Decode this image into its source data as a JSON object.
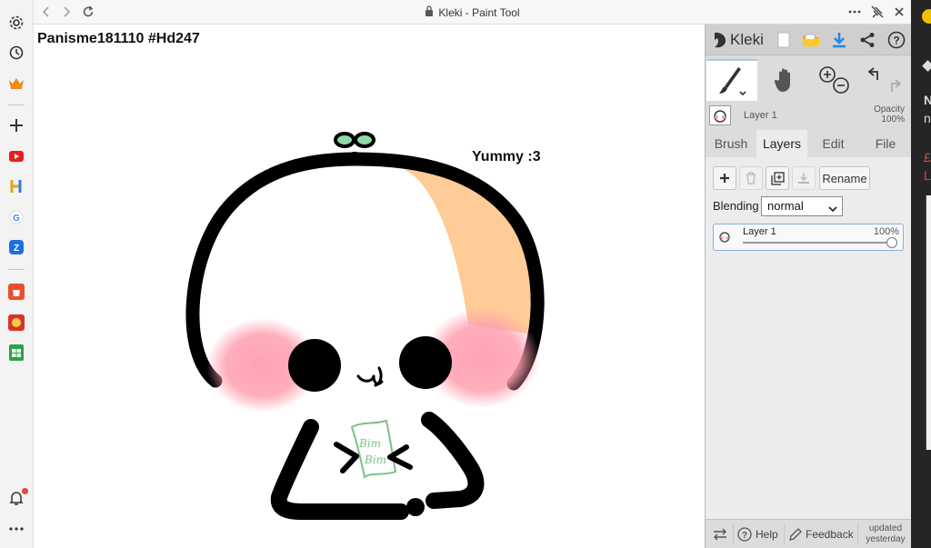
{
  "browser": {
    "window_title": "Kleki - Paint Tool",
    "sidebar_icons": [
      "settings-icon",
      "history-icon",
      "crown-icon",
      "plus-icon",
      "youtube-icon",
      "h-app-icon",
      "google-icon",
      "zalo-icon",
      "shopee-icon",
      "game-icon",
      "sheets-icon",
      "bell-icon",
      "more-icon"
    ]
  },
  "canvas": {
    "title_text": "Panisme181110 #Hd247",
    "note_text": "Yummy :3",
    "bag_text_line1": "Bim",
    "bag_text_line2": "Bim",
    "colors": {
      "outline": "#000000",
      "blush": "#ff9fb0",
      "stripe": "#ffcb96",
      "sprout": "#8fd9a8",
      "bag": "#7fbf87"
    }
  },
  "panel": {
    "brand": "Kleki",
    "layer_preview_name": "Layer 1",
    "opacity_label": "Opacity",
    "opacity_value": "100%",
    "tabs": [
      {
        "label": "Brush",
        "active": false
      },
      {
        "label": "Layers",
        "active": true
      },
      {
        "label": "Edit",
        "active": false
      },
      {
        "label": "File",
        "active": false
      }
    ],
    "rename_label": "Rename",
    "blending_label": "Blending",
    "blending_value": "normal",
    "layers": [
      {
        "name": "Layer 1",
        "opacity": "100%",
        "opacity_fraction": 1.0
      }
    ],
    "footer": {
      "help": "Help",
      "feedback": "Feedback",
      "updated_line1": "updated",
      "updated_line2": "yesterday"
    }
  },
  "edge_window": {
    "chars": [
      "N",
      "n",
      "£",
      "L"
    ]
  }
}
